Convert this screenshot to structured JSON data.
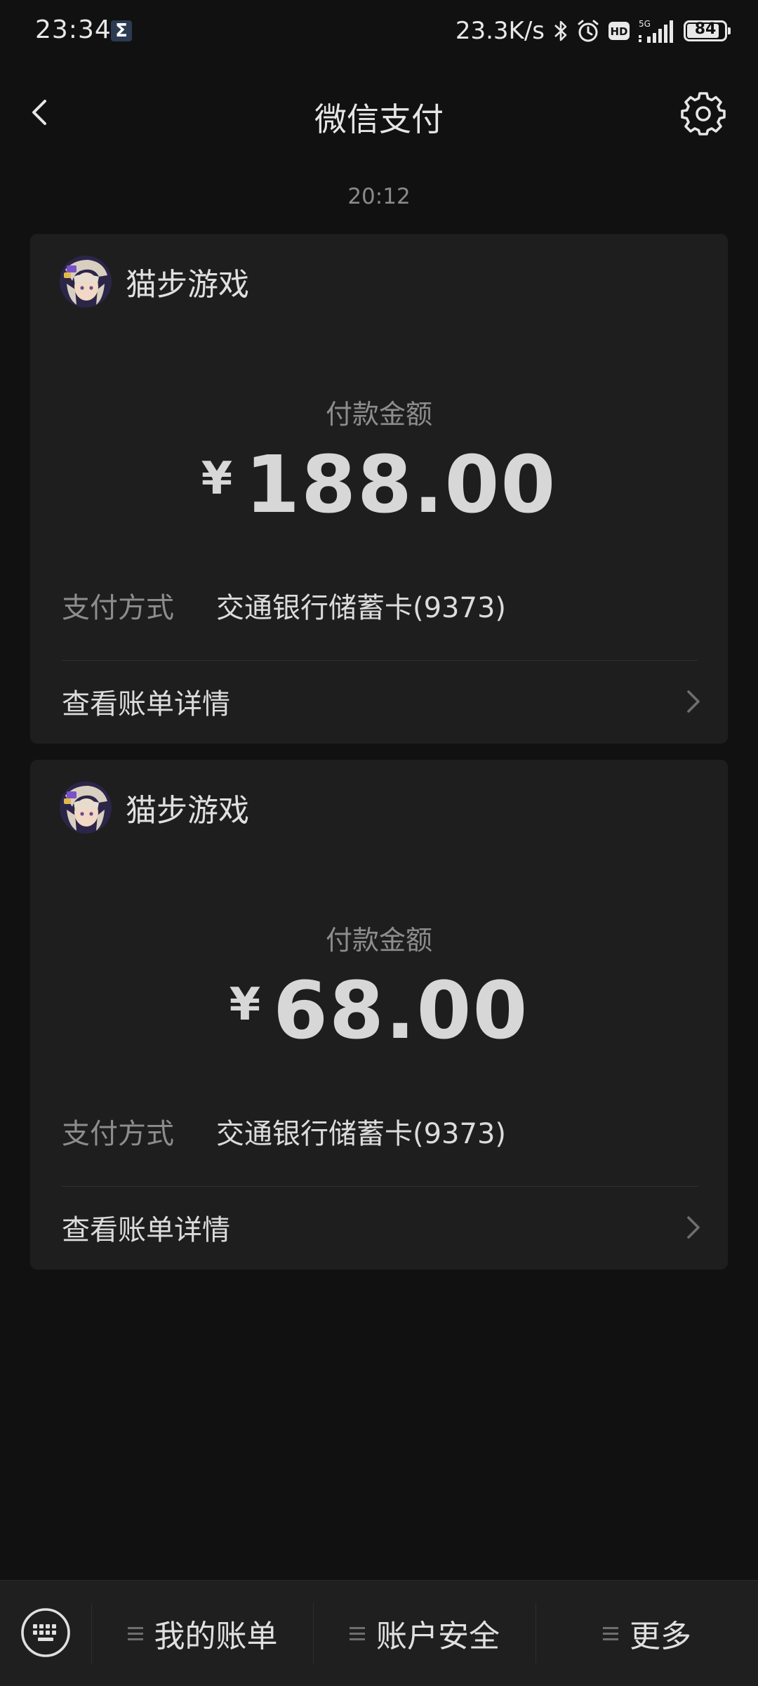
{
  "status_bar": {
    "time": "23:34",
    "notification_icon": "sigma-icon",
    "net_speed": "23.3K/s",
    "network_label": "5G",
    "hd_label": "HD",
    "battery_level": "84"
  },
  "nav": {
    "title": "微信支付",
    "back_icon": "chevron-left-icon",
    "settings_icon": "gear-icon"
  },
  "message_time": "20:12",
  "payments": [
    {
      "merchant": "猫步游戏",
      "amount_label": "付款金额",
      "currency": "¥",
      "amount": "188.00",
      "method_label": "支付方式",
      "method_value": "交通银行储蓄卡(9373)",
      "detail_label": "查看账单详情"
    },
    {
      "merchant": "猫步游戏",
      "amount_label": "付款金额",
      "currency": "¥",
      "amount": "68.00",
      "method_label": "支付方式",
      "method_value": "交通银行储蓄卡(9373)",
      "detail_label": "查看账单详情"
    }
  ],
  "bottom_menu": {
    "keyboard_icon": "keyboard-icon",
    "items": [
      {
        "label": "我的账单"
      },
      {
        "label": "账户安全"
      },
      {
        "label": "更多"
      }
    ]
  },
  "colors": {
    "background": "#111111",
    "card": "#1e1e1e",
    "bottom_bar": "#1f1f1f",
    "primary_text": "#e6e6e6",
    "secondary_text": "#8d8d8d"
  }
}
